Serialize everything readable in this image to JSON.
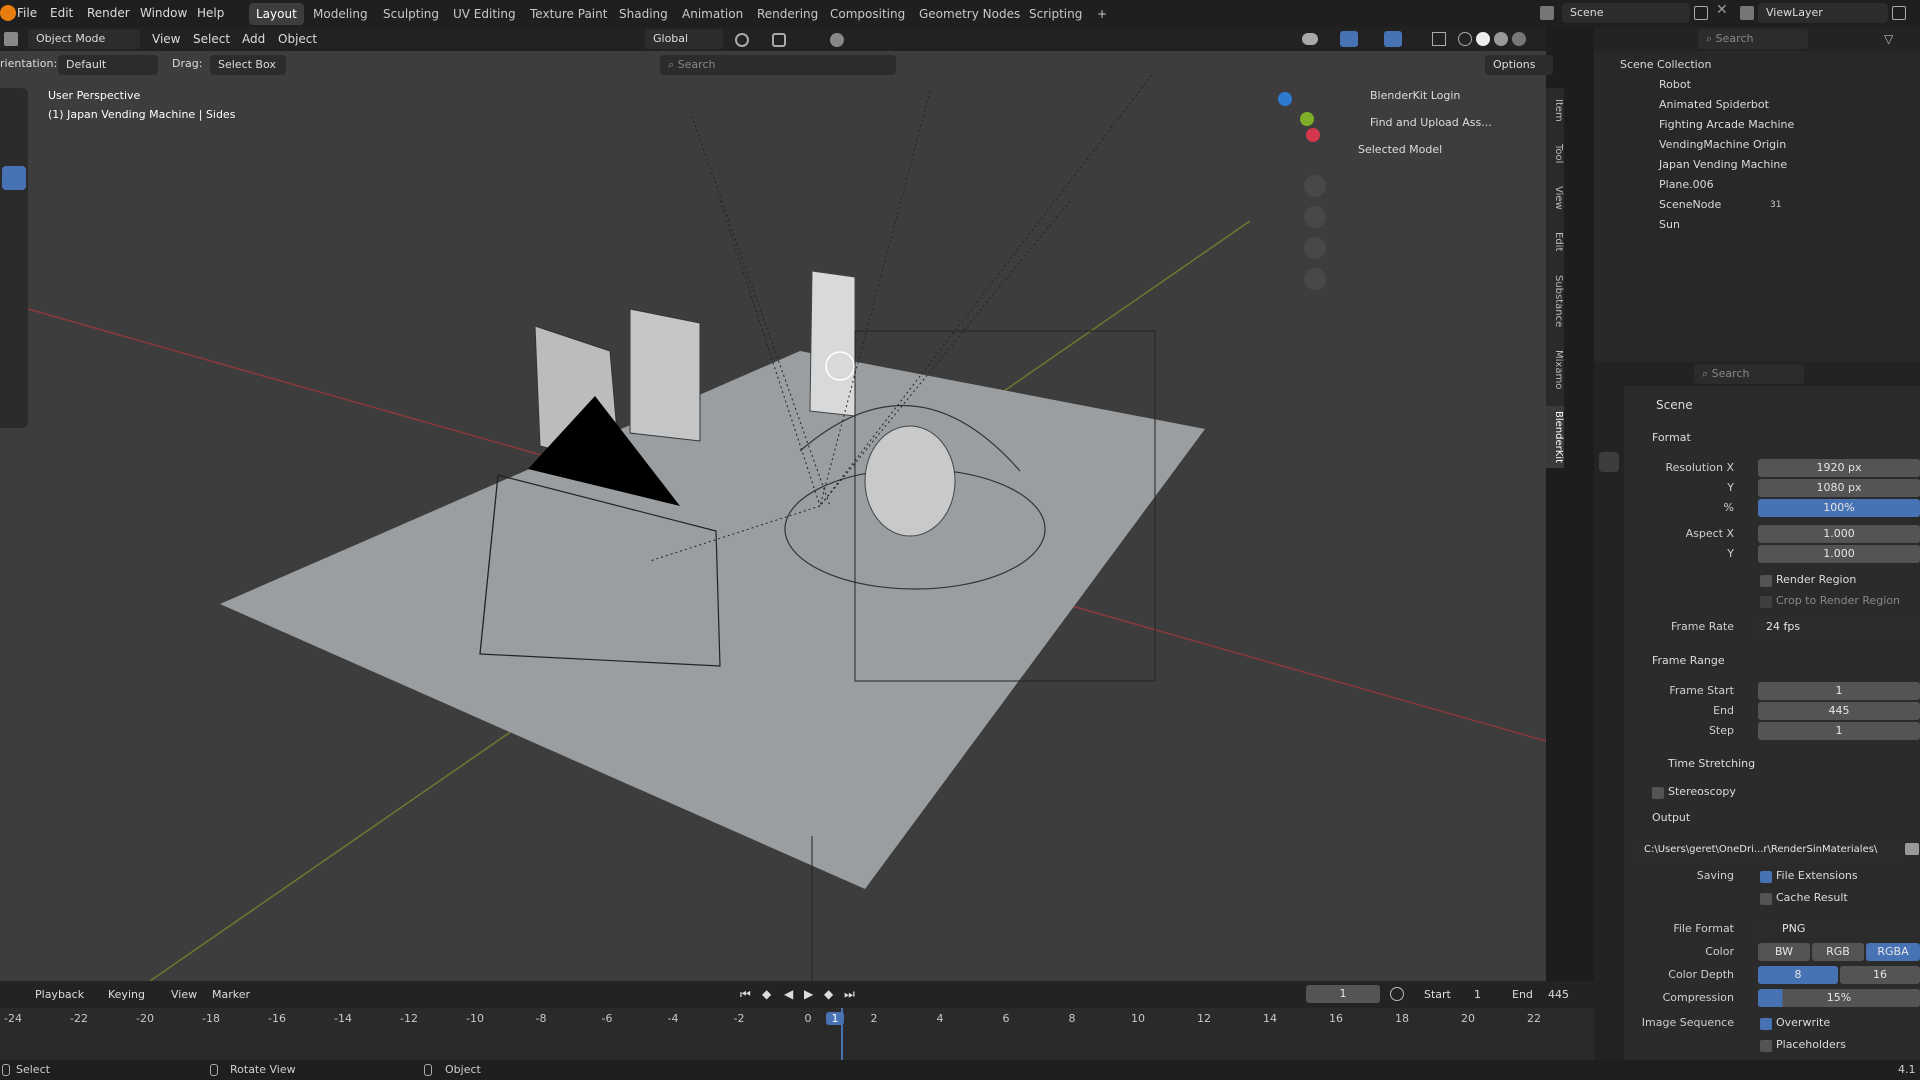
{
  "app": {
    "menus": [
      "File",
      "Edit",
      "Render",
      "Window",
      "Help"
    ],
    "workspaces": [
      "Layout",
      "Modeling",
      "Sculpting",
      "UV Editing",
      "Texture Paint",
      "Shading",
      "Animation",
      "Rendering",
      "Compositing",
      "Geometry Nodes",
      "Scripting"
    ],
    "active_workspace": "Layout",
    "add_tab": "+",
    "scene_name": "Scene",
    "view_layer": "ViewLayer"
  },
  "viewport": {
    "mode": "Object Mode",
    "menu": [
      "View",
      "Select",
      "Add",
      "Object"
    ],
    "transform": "Global",
    "orientation_label": "rientation:",
    "orientation_value": "Default",
    "drag_label": "Drag:",
    "drag_value": "Select Box",
    "search_placeholder": "Search",
    "options": "Options",
    "overlay_title": "User Perspective",
    "overlay_subtitle": "(1) Japan Vending Machine | Sides"
  },
  "npanel": {
    "items": [
      "BlenderKit Login",
      "Find and Upload Ass...",
      "Selected Model"
    ],
    "tabs": [
      "Item",
      "Tool",
      "View",
      "Edit",
      "Substance",
      "Mixamo",
      "BlenderKit"
    ]
  },
  "outliner": {
    "search_placeholder": "Search",
    "root": "Scene Collection",
    "items": [
      {
        "name": "Robot"
      },
      {
        "name": "Animated Spiderbot"
      },
      {
        "name": "Fighting Arcade Machine"
      },
      {
        "name": "VendingMachine Origin"
      },
      {
        "name": "Japan Vending Machine"
      },
      {
        "name": "Plane.006"
      },
      {
        "name": "SceneNode",
        "badge": "31"
      },
      {
        "name": "Sun"
      }
    ]
  },
  "properties": {
    "search_placeholder": "Search",
    "context": "Scene",
    "format": {
      "title": "Format",
      "resolution_x_label": "Resolution X",
      "resolution_x": "1920 px",
      "y_label": "Y",
      "resolution_y": "1080 px",
      "percent_label": "%",
      "percent": "100%",
      "aspect_x_label": "Aspect X",
      "aspect_x": "1.000",
      "aspect_y_label": "Y",
      "aspect_y": "1.000",
      "render_region": "Render Region",
      "crop": "Crop to Render Region",
      "frame_rate_label": "Frame Rate",
      "frame_rate": "24 fps"
    },
    "frame_range": {
      "title": "Frame Range",
      "start_label": "Frame Start",
      "start": "1",
      "end_label": "End",
      "end": "445",
      "step_label": "Step",
      "step": "1",
      "time_stretching": "Time Stretching"
    },
    "stereoscopy": "Stereoscopy",
    "output": {
      "title": "Output",
      "path": "C:\\Users\\geret\\OneDri...r\\RenderSinMateriales\\",
      "saving_label": "Saving",
      "file_extensions": "File Extensions",
      "cache_result": "Cache Result",
      "file_format_label": "File Format",
      "file_format": "PNG",
      "color_label": "Color",
      "color_options": [
        "BW",
        "RGB",
        "RGBA"
      ],
      "color_depth_label": "Color Depth",
      "depth_options": [
        "8",
        "16"
      ],
      "compression_label": "Compression",
      "compression": "15%",
      "image_sequence_label": "Image Sequence",
      "overwrite": "Overwrite",
      "placeholders": "Placeholders"
    }
  },
  "timeline": {
    "menu": [
      "Playback",
      "Keying",
      "View",
      "Marker"
    ],
    "current_frame": "1",
    "start_label": "Start",
    "start": "1",
    "end_label": "End",
    "end": "445",
    "ticks": [
      "-24",
      "-22",
      "-20",
      "-18",
      "-16",
      "-14",
      "-12",
      "-10",
      "-8",
      "-6",
      "-4",
      "-2",
      "0",
      "1",
      "2",
      "4",
      "6",
      "8",
      "10",
      "12",
      "14",
      "16",
      "18",
      "20",
      "22"
    ]
  },
  "statusbar": {
    "items": [
      "Select",
      "Rotate View",
      "Object"
    ],
    "version": "4.1"
  },
  "colors": {
    "accent": "#4772b3",
    "viewport_bg": "#3d3d3d",
    "panel_bg": "#2b2b2b"
  }
}
